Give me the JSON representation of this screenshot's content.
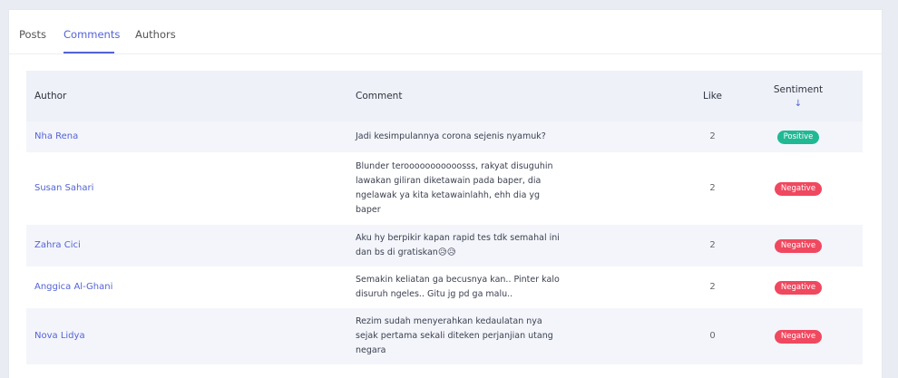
{
  "tabs": [
    {
      "label": "Posts"
    },
    {
      "label": "Comments"
    },
    {
      "label": "Authors"
    }
  ],
  "active_tab": "Comments",
  "table": {
    "headers": {
      "author": "Author",
      "comment": "Comment",
      "like": "Like",
      "sentiment": "Sentiment",
      "sort_icon": "arrow-down-icon"
    },
    "rows": [
      {
        "author": "Nha Rena",
        "comment_lines": [
          "Jadi kesimpulannya corona sejenis nyamuk?"
        ],
        "like": "2",
        "sentiment": "Positive"
      },
      {
        "author": "Susan Sahari",
        "comment_lines": [
          "Blunder terooooooooooosss, rakyat disuguhin",
          "lawakan giliran diketawain pada baper, dia",
          "ngelawak ya kita ketawainlahh, ehh dia yg",
          "baper"
        ],
        "like": "2",
        "sentiment": "Negative"
      },
      {
        "author": "Zahra Cici",
        "comment_lines": [
          "Aku hy berpikir kapan rapid tes tdk semahal ini",
          "dan bs di gratiskan😥😥"
        ],
        "like": "2",
        "sentiment": "Negative"
      },
      {
        "author": "Anggica Al-Ghani",
        "comment_lines": [
          "Semakin keliatan ga becusnya kan.. Pinter kalo",
          "disuruh ngeles.. Gitu jg pd ga malu.."
        ],
        "like": "2",
        "sentiment": "Negative"
      },
      {
        "author": "Nova Lidya",
        "comment_lines": [
          "Rezim sudah menyerahkan kedaulatan nya",
          "sejak pertama sekali diteken perjanjian utang",
          "negara"
        ],
        "like": "0",
        "sentiment": "Negative"
      }
    ]
  },
  "colors": {
    "accent": "#5463d6",
    "positive": "#20b994",
    "negative": "#f0485f",
    "header_bg": "#eef1f8",
    "stripe_bg": "#f3f5fb"
  }
}
